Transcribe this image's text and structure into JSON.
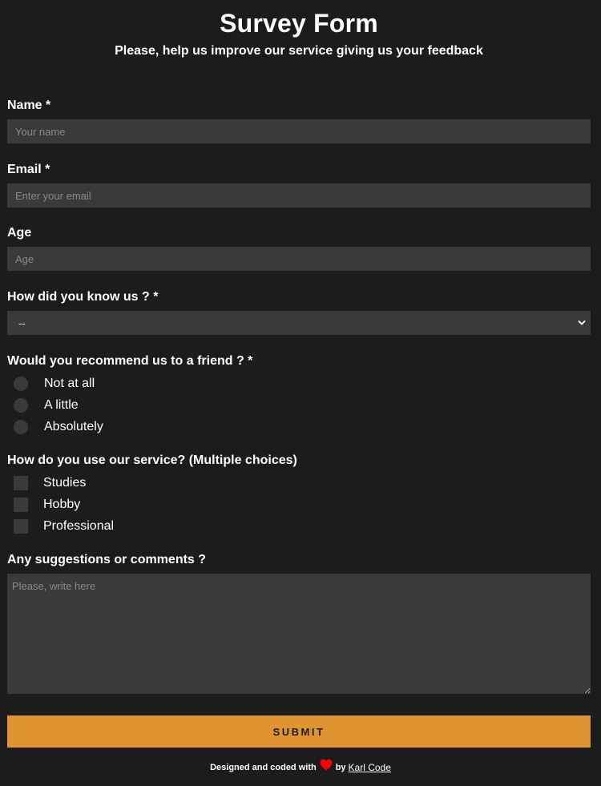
{
  "header": {
    "title": "Survey Form",
    "subtitle": "Please, help us improve our service giving us your feedback"
  },
  "form": {
    "name": {
      "label": "Name *",
      "placeholder": "Your name",
      "value": ""
    },
    "email": {
      "label": "Email *",
      "placeholder": "Enter your email",
      "value": ""
    },
    "age": {
      "label": "Age",
      "placeholder": "Age",
      "value": ""
    },
    "source": {
      "label": "How did you know us ? *",
      "selected": "--"
    },
    "recommend": {
      "label": "Would you recommend us to a friend ? *",
      "options": [
        "Not at all",
        "A little",
        "Absolutely"
      ]
    },
    "usage": {
      "label": "How do you use our service? (Multiple choices)",
      "options": [
        "Studies",
        "Hobby",
        "Professional"
      ]
    },
    "comments": {
      "label": "Any suggestions or comments ?",
      "placeholder": "Please, write here",
      "value": ""
    },
    "submit_label": "SUBMIT"
  },
  "footer": {
    "text_before": "Designed and coded with",
    "text_by": "by",
    "link_label": "Karl Code",
    "heart_icon": "heart-icon"
  },
  "colors": {
    "background": "#1d1c1c",
    "input_bg": "#3b3a3b",
    "accent": "#e09431",
    "heart": "#ff0000"
  }
}
